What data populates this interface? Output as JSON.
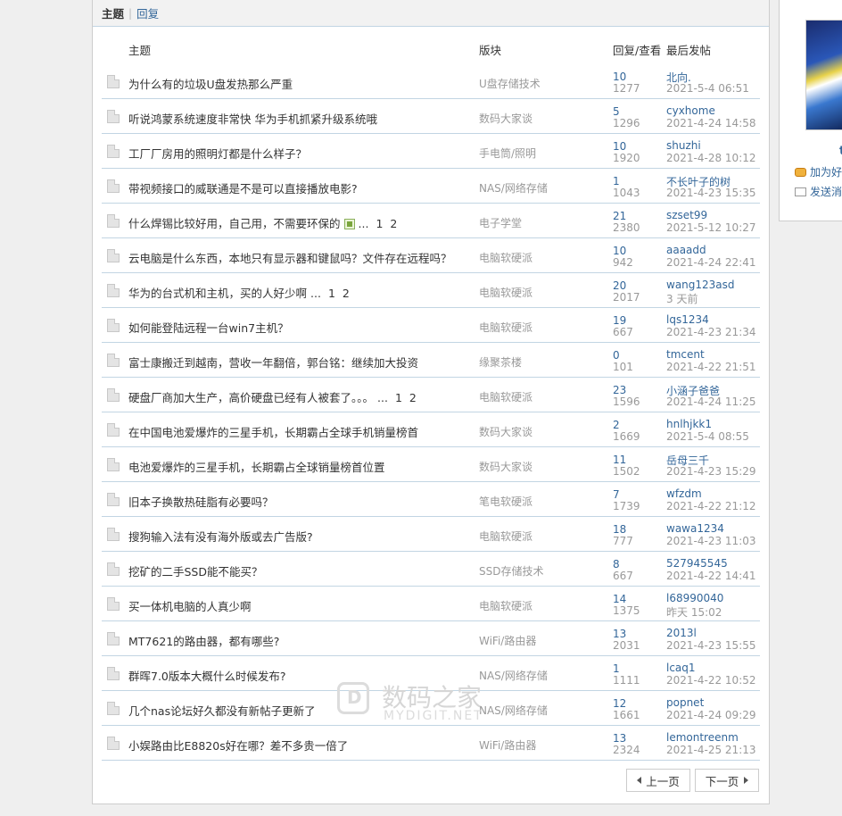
{
  "tabs": {
    "active": "主题",
    "separator": "|",
    "other": "回复"
  },
  "table_header": {
    "title": "主题",
    "forum": "版块",
    "stats": "回复/查看",
    "last": "最后发帖"
  },
  "threads": [
    {
      "title": "为什么有的垃圾U盘发热那么严重",
      "forum": "U盘存储技术",
      "replies": "10",
      "views": "1277",
      "last_user": "北向.",
      "last_time": "2021-5-4 06:51"
    },
    {
      "title": "听说鸿蒙系统速度非常快 华为手机抓紧升级系统哦",
      "forum": "数码大家谈",
      "replies": "5",
      "views": "1296",
      "last_user": "cyxhome",
      "last_time": "2021-4-24 14:58"
    },
    {
      "title": "工厂厂房用的照明灯都是什么样子？",
      "forum": "手电筒/照明",
      "replies": "10",
      "views": "1920",
      "last_user": "shuzhi",
      "last_time": "2021-4-28 10:12"
    },
    {
      "title": "带视频接口的威联通是不是可以直接播放电影?",
      "forum": "NAS/网络存储",
      "replies": "1",
      "views": "1043",
      "last_user": "不长叶子的树",
      "last_time": "2021-4-23 15:35"
    },
    {
      "title": "什么焊锡比较好用，自己用，不需要环保的",
      "forum": "电子学堂",
      "replies": "21",
      "views": "2380",
      "last_user": "szset99",
      "last_time": "2021-5-12 10:27",
      "attach": true,
      "ellipsis": "...",
      "pages": [
        "1",
        "2"
      ]
    },
    {
      "title": "云电脑是什么东西，本地只有显示器和键鼠吗？文件存在远程吗？",
      "forum": "电脑软硬派",
      "replies": "10",
      "views": "942",
      "last_user": "aaaadd",
      "last_time": "2021-4-24 22:41"
    },
    {
      "title": "华为的台式机和主机，买的人好少啊",
      "forum": "电脑软硬派",
      "replies": "20",
      "views": "2017",
      "last_user": "wang123asd",
      "last_time": "3 天前",
      "ellipsis": "...",
      "pages": [
        "1",
        "2"
      ]
    },
    {
      "title": "如何能登陆远程一台win7主机？",
      "forum": "电脑软硬派",
      "replies": "19",
      "views": "667",
      "last_user": "lqs1234",
      "last_time": "2021-4-23 21:34"
    },
    {
      "title": "富士康搬迁到越南，营收一年翻倍，郭台铭：继续加大投资",
      "forum": "缘聚茶楼",
      "replies": "0",
      "views": "101",
      "last_user": "tmcent",
      "last_time": "2021-4-22 21:51"
    },
    {
      "title": "硬盘厂商加大生产，高价硬盘已经有人被套了。。。",
      "forum": "电脑软硬派",
      "replies": "23",
      "views": "1596",
      "last_user": "小涵子爸爸",
      "last_time": "2021-4-24 11:25",
      "ellipsis": "...",
      "pages": [
        "1",
        "2"
      ]
    },
    {
      "title": "在中国电池爱爆炸的三星手机，长期霸占全球手机销量榜首",
      "forum": "数码大家谈",
      "replies": "2",
      "views": "1669",
      "last_user": "hnlhjkk1",
      "last_time": "2021-5-4 08:55"
    },
    {
      "title": "电池爱爆炸的三星手机，长期霸占全球销量榜首位置",
      "forum": "数码大家谈",
      "replies": "11",
      "views": "1502",
      "last_user": "岳母三千",
      "last_time": "2021-4-23 15:29"
    },
    {
      "title": "旧本子换散热硅脂有必要吗？",
      "forum": "笔电软硬派",
      "replies": "7",
      "views": "1739",
      "last_user": "wfzdm",
      "last_time": "2021-4-22 21:12"
    },
    {
      "title": "搜狗输入法有没有海外版或去广告版?",
      "forum": "电脑软硬派",
      "replies": "18",
      "views": "777",
      "last_user": "wawa1234",
      "last_time": "2021-4-23 11:03"
    },
    {
      "title": "挖矿的二手SSD能不能买？",
      "forum": "SSD存储技术",
      "replies": "8",
      "views": "667",
      "last_user": "527945545",
      "last_time": "2021-4-22 14:41"
    },
    {
      "title": "买一体机电脑的人真少啊",
      "forum": "电脑软硬派",
      "replies": "14",
      "views": "1375",
      "last_user": "l68990040",
      "last_time": "昨天 15:02"
    },
    {
      "title": "MT7621的路由器，都有哪些?",
      "forum": "WiFi/路由器",
      "replies": "13",
      "views": "2031",
      "last_user": "2013l",
      "last_time": "2021-4-23 15:55"
    },
    {
      "title": "群晖7.0版本大概什么时候发布?",
      "forum": "NAS/网络存储",
      "replies": "1",
      "views": "1111",
      "last_user": "lcaq1",
      "last_time": "2021-4-22 10:52"
    },
    {
      "title": "几个nas论坛好久都没有新帖子更新了",
      "forum": "NAS/网络存储",
      "replies": "12",
      "views": "1661",
      "last_user": "popnet",
      "last_time": "2021-4-24 09:29"
    },
    {
      "title": "小娱路由比E8820s好在哪？差不多贵一倍了",
      "forum": "WiFi/路由器",
      "replies": "13",
      "views": "2324",
      "last_user": "lemontreenm",
      "last_time": "2021-4-25 21:13"
    }
  ],
  "pager": {
    "prev": "上一页",
    "next": "下一页"
  },
  "profile": {
    "name": "t",
    "add_friend": "加为好",
    "send_msg": "发送消"
  },
  "watermark": {
    "cn": "数码之家",
    "en": "MYDIGIT.NET"
  },
  "colors": {
    "link": "#336699",
    "muted": "#999999",
    "row_border": "#c2d5e3"
  }
}
